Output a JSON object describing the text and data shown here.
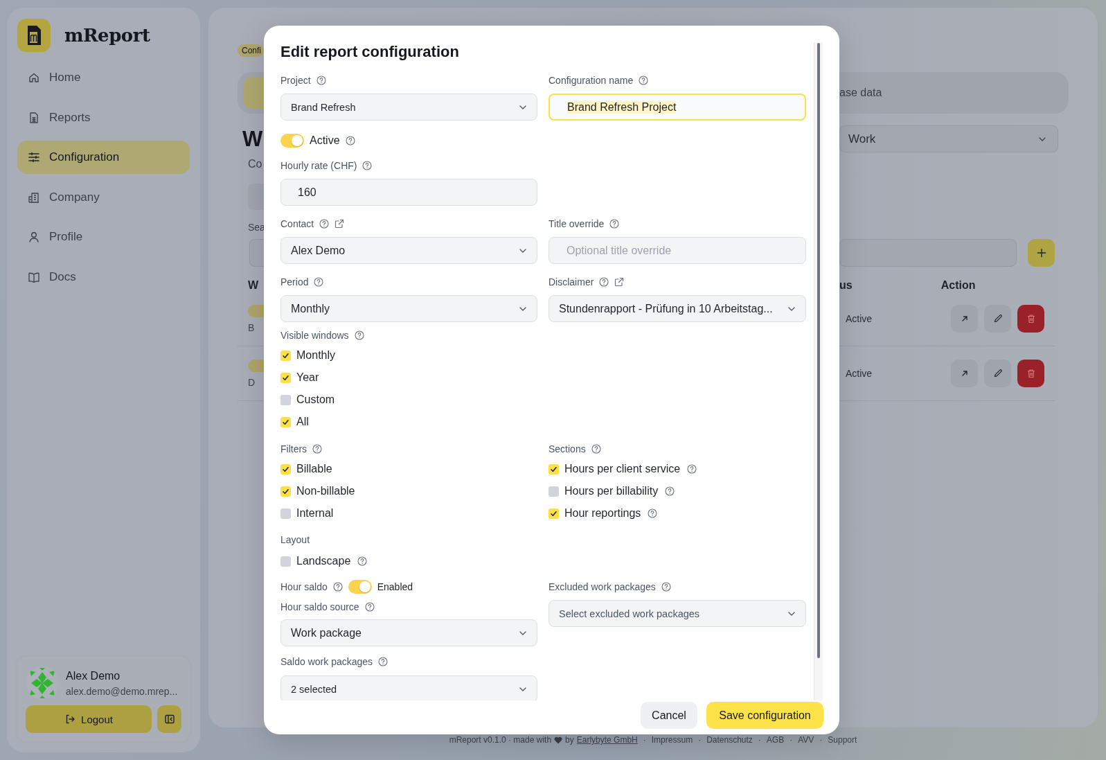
{
  "sidebar": {
    "app_name": "mReport",
    "nav": [
      {
        "label": "Home",
        "selected": false
      },
      {
        "label": "Reports",
        "selected": false
      },
      {
        "label": "Configuration",
        "selected": true
      },
      {
        "label": "Company",
        "selected": false
      },
      {
        "label": "Profile",
        "selected": false
      },
      {
        "label": "Docs",
        "selected": false
      }
    ],
    "user": {
      "name": "Alex Demo",
      "email": "alex.demo@demo.mrep..."
    },
    "logout": "Logout"
  },
  "background": {
    "breadcrumb": "Confi",
    "tab_label": "ase data",
    "heading": "W",
    "subtitle": "Co",
    "search_label": "Sea",
    "filter_value": "Work",
    "column_1": "W",
    "column_status": "us",
    "column_action": "Action",
    "rows": [
      {
        "text": "B",
        "status": "Active"
      },
      {
        "text": "D",
        "status": "Active"
      }
    ]
  },
  "modal": {
    "title": "Edit report configuration",
    "project": {
      "label": "Project",
      "value": "Brand Refresh"
    },
    "config_name": {
      "label": "Configuration name",
      "value": "Brand Refresh Project"
    },
    "active": {
      "label": "Active",
      "on": true
    },
    "hourly_rate": {
      "label": "Hourly rate (CHF)",
      "value": "160"
    },
    "contact": {
      "label": "Contact",
      "value": "Alex Demo"
    },
    "title_override": {
      "label": "Title override",
      "placeholder": "Optional title override"
    },
    "period": {
      "label": "Period",
      "value": "Monthly"
    },
    "disclaimer": {
      "label": "Disclaimer",
      "value": "Stundenrapport - Prüfung in 10 Arbeitstag..."
    },
    "visible_windows": {
      "label": "Visible windows",
      "options": [
        {
          "label": "Monthly",
          "checked": true
        },
        {
          "label": "Year",
          "checked": true
        },
        {
          "label": "Custom",
          "checked": false
        },
        {
          "label": "All",
          "checked": true
        }
      ]
    },
    "filters": {
      "label": "Filters",
      "options": [
        {
          "label": "Billable",
          "checked": true
        },
        {
          "label": "Non-billable",
          "checked": true
        },
        {
          "label": "Internal",
          "checked": false
        }
      ]
    },
    "sections": {
      "label": "Sections",
      "options": [
        {
          "label": "Hours per client service",
          "checked": true
        },
        {
          "label": "Hours per billability",
          "checked": false
        },
        {
          "label": "Hour reportings",
          "checked": true
        }
      ]
    },
    "layout": {
      "label": "Layout",
      "options": [
        {
          "label": "Landscape",
          "checked": false
        }
      ]
    },
    "hour_saldo": {
      "label": "Hour saldo",
      "on": true,
      "state_label": "Enabled"
    },
    "hour_saldo_source": {
      "label": "Hour saldo source",
      "value": "Work package"
    },
    "saldo_work_packages": {
      "label": "Saldo work packages",
      "value": "2 selected"
    },
    "excluded_work_packages": {
      "label": "Excluded work packages",
      "placeholder": "Select excluded work packages"
    },
    "cancel": "Cancel",
    "save": "Save configuration"
  },
  "footer": {
    "intro": "mReport v0.1.0 · made with",
    "by": "by",
    "company": "Earlybyte GmbH",
    "links": [
      {
        "sep": "·",
        "label": "Impressum"
      },
      {
        "sep": "·",
        "label": "Datenschutz"
      },
      {
        "sep": "·",
        "label": "AGB"
      },
      {
        "sep": "·",
        "label": "AVV"
      },
      {
        "sep": "·",
        "label": "Support"
      }
    ]
  }
}
